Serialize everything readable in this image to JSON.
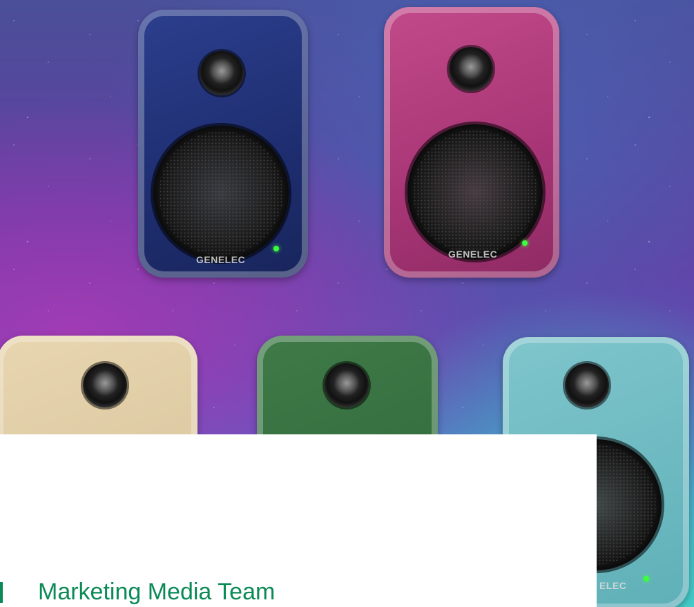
{
  "hero": {
    "image_alt": "Genelec speakers in five colours on a starry background",
    "speakers": [
      {
        "color_name": "blue",
        "color": "#1e2d6f",
        "brand": "GENELEC"
      },
      {
        "color_name": "pink",
        "color": "#a73575",
        "brand": "GENELEC"
      },
      {
        "color_name": "cream",
        "color": "#d4c098",
        "brand": ""
      },
      {
        "color_name": "green",
        "color": "#2e6538",
        "brand": ""
      },
      {
        "color_name": "teal",
        "color": "#5fb0b8",
        "brand": "ELEC"
      }
    ]
  },
  "card": {
    "title": "Marketing Media Team",
    "accent_color": "#0a8a55"
  }
}
